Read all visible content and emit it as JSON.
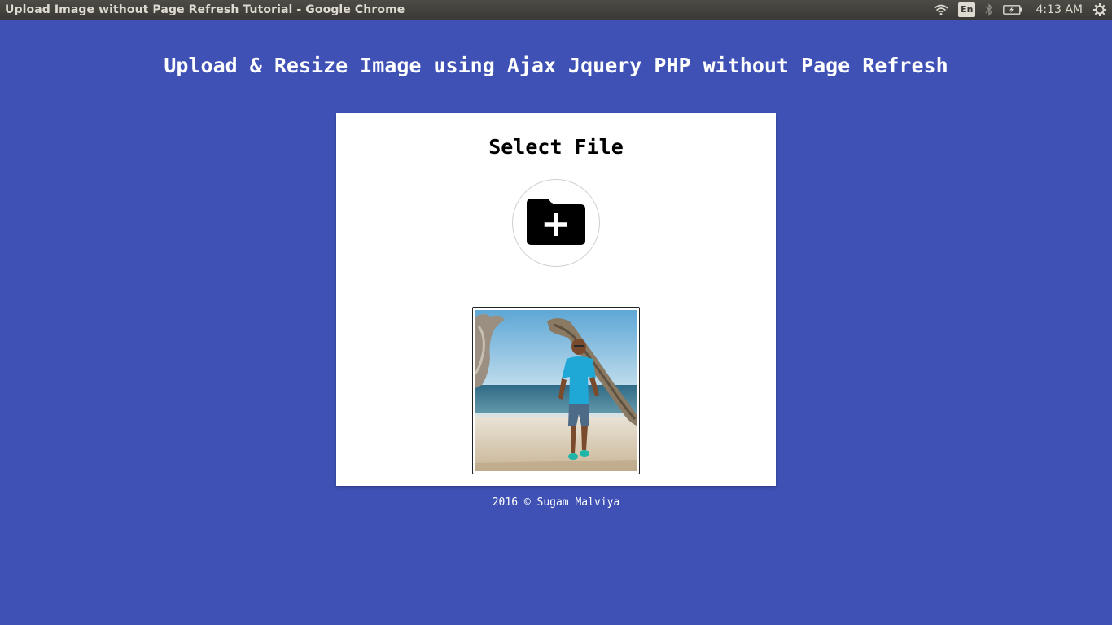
{
  "window": {
    "title": "Upload Image without Page Refresh Tutorial - Google Chrome"
  },
  "system_tray": {
    "keyboard_layout": "En",
    "clock": "4:13 AM",
    "icons": [
      "wifi-icon",
      "bluetooth-icon",
      "battery-icon",
      "settings-icon"
    ]
  },
  "page": {
    "heading": "Upload & Resize Image using Ajax Jquery PHP without Page Refresh",
    "card_title": "Select File",
    "upload_icon": "folder-add-icon",
    "footer": "2016 © Sugam Malviya"
  },
  "colors": {
    "background": "#3f51b5",
    "card": "#ffffff",
    "topbar": "#3b3a36"
  }
}
